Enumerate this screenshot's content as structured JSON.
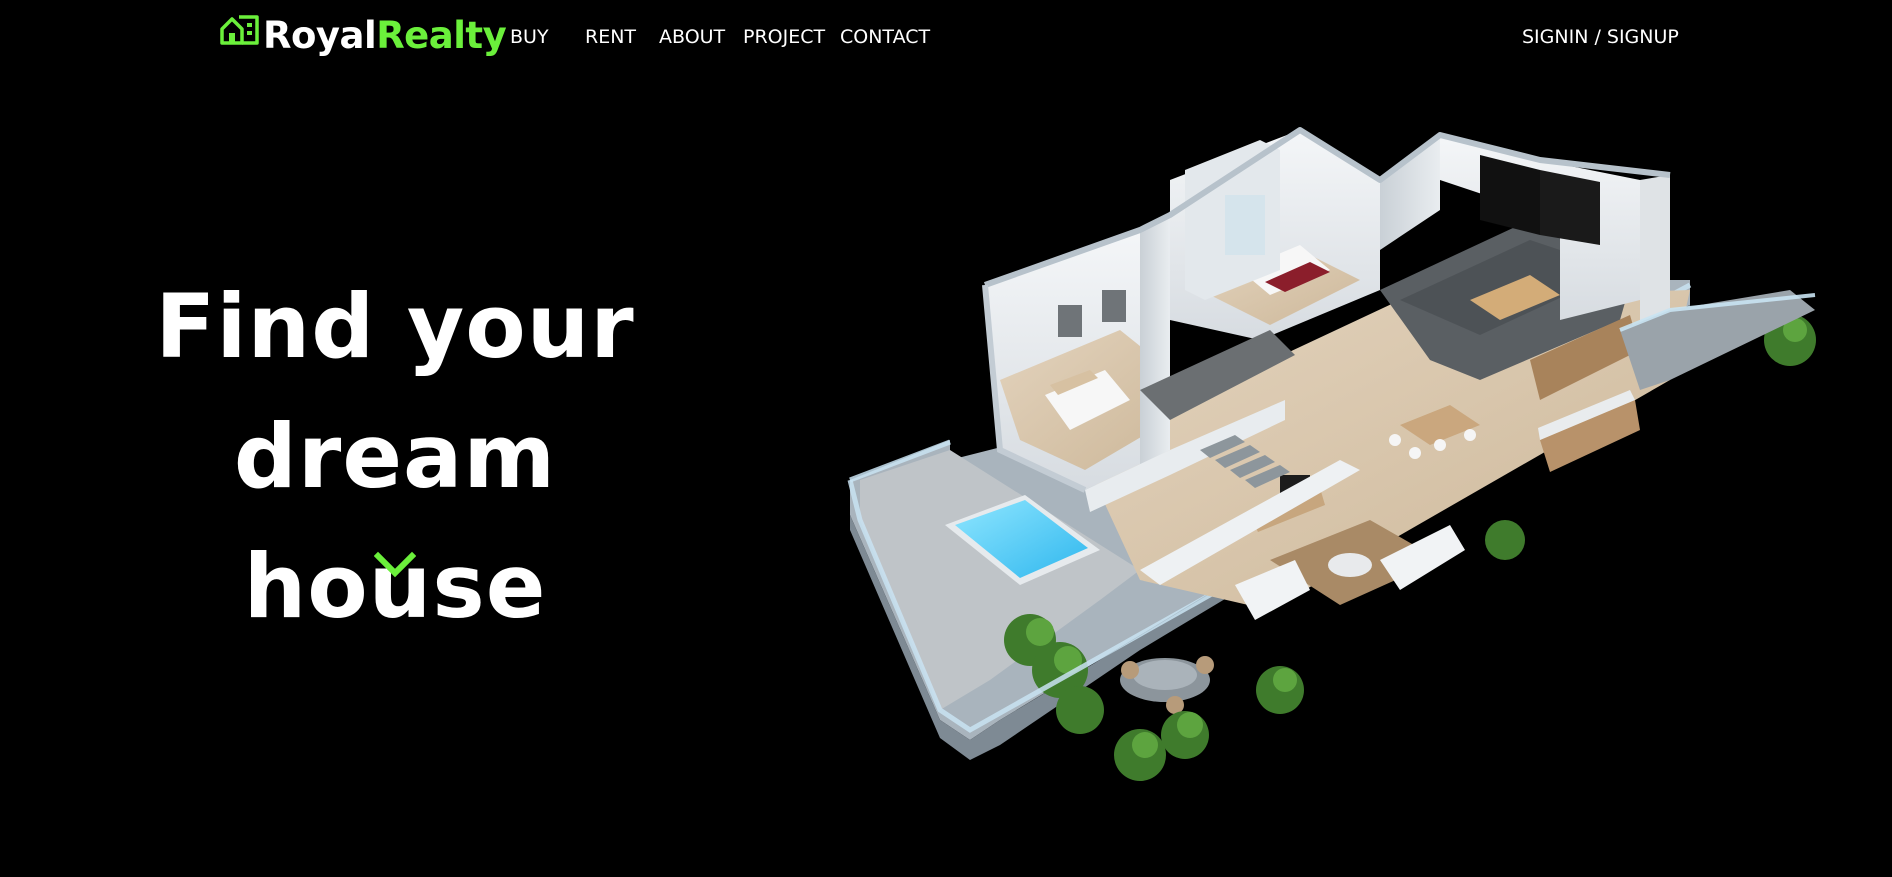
{
  "brand": {
    "name_part1": "Royal",
    "name_part2": "Realty",
    "accent_color": "#6bf03b",
    "icon": "house-building-icon"
  },
  "nav": {
    "buy": "BUY",
    "rent": "RENT",
    "about": "ABOUT",
    "project": "PROJECT",
    "contact": "CONTACT"
  },
  "auth": {
    "label": "SIGNIN / SIGNUP"
  },
  "hero": {
    "title_line1": "Find your dream",
    "title_line2": "house",
    "scroll_icon": "chevron-down-icon"
  },
  "colors": {
    "background": "#000000",
    "text": "#ffffff",
    "accent": "#6bf03b"
  }
}
